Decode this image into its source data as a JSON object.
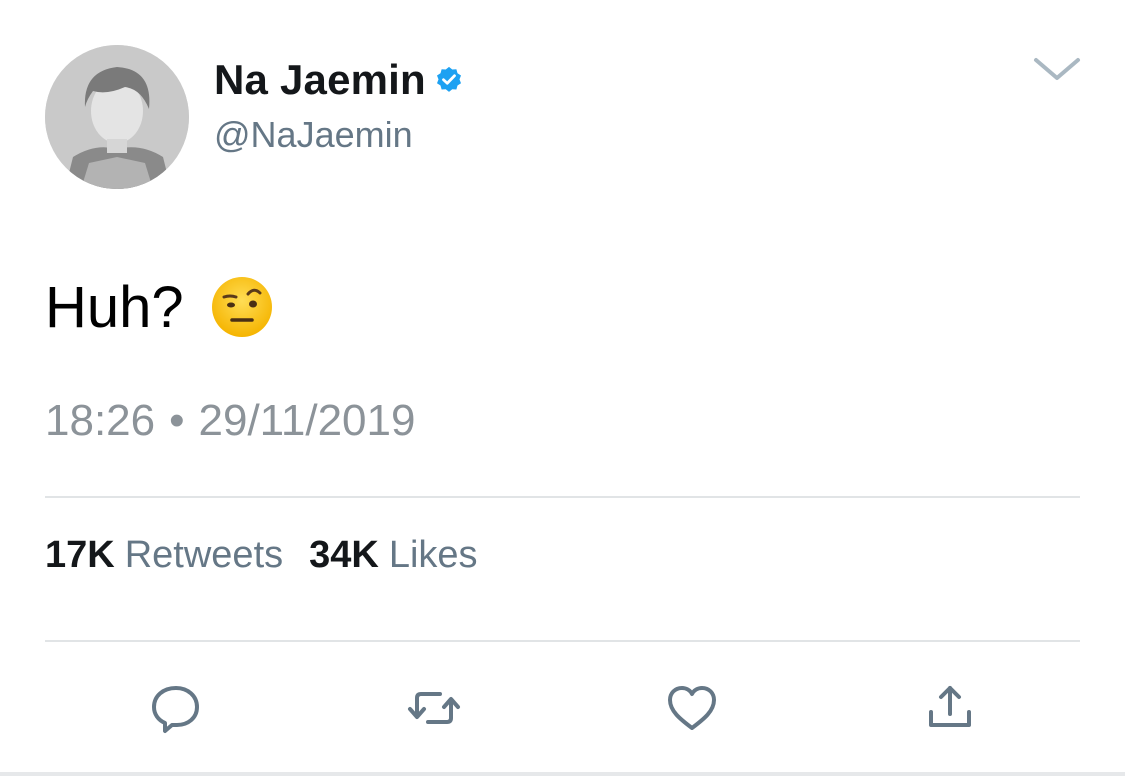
{
  "author": {
    "display_name": "Na Jaemin",
    "handle": "@NaJaemin",
    "verified": true
  },
  "tweet": {
    "text": "Huh?",
    "emoji": "face-with-raised-eyebrow"
  },
  "meta": {
    "time": "18:26",
    "separator": "•",
    "date": "29/11/2019"
  },
  "stats": {
    "retweets_count": "17K",
    "retweets_label": "Retweets",
    "likes_count": "34K",
    "likes_label": "Likes"
  },
  "actions": [
    "reply-icon",
    "retweet-icon",
    "like-icon",
    "share-icon"
  ],
  "colors": {
    "verified_blue": "#1da1f2",
    "icon_gray": "#657786",
    "divider": "#e1e4e6"
  }
}
